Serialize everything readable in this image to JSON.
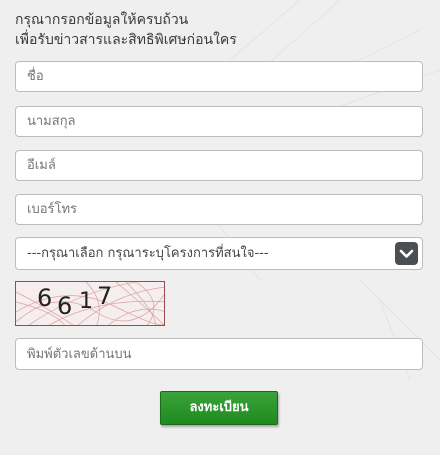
{
  "heading": {
    "line1": "กรุณากรอกข้อมูลให้ครบถ้วน",
    "line2": "เพื่อรับข่าวสารและสิทธิพิเศษก่อนใคร"
  },
  "fields": {
    "name_placeholder": "ชื่อ",
    "surname_placeholder": "นามสกุล",
    "email_placeholder": "อีเมล์",
    "phone_placeholder": "เบอร์โทร",
    "captcha_input_placeholder": "พิมพ์ตัวเลขด้านบน"
  },
  "project_select": {
    "selected": "---กรุณาเลือก กรุณาระบุโครงการที่สนใจ---",
    "icon": "chevron-down-icon"
  },
  "captcha": {
    "digits": [
      "6",
      "6",
      "1",
      "7"
    ]
  },
  "submit": {
    "label": "ลงทะเบียน",
    "color": "#2a962a"
  },
  "colors": {
    "background": "#efefef",
    "field_border": "#bdbdbd",
    "select_button": "#4a4f54"
  }
}
